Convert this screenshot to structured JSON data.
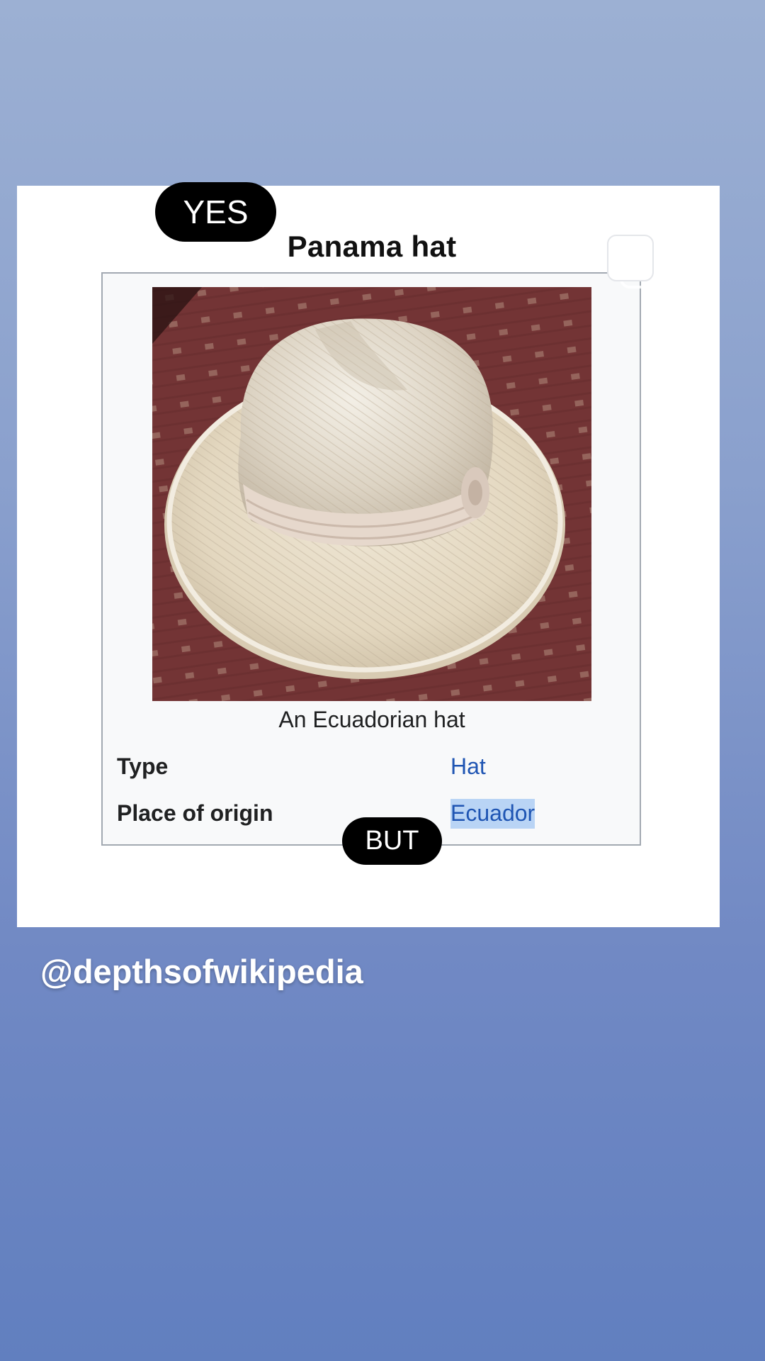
{
  "stickers": {
    "yes": "YES",
    "but": "BUT"
  },
  "infobox": {
    "title": "Panama hat",
    "image_caption": "An Ecuadorian hat",
    "rows": [
      {
        "label": "Type",
        "value": "Hat"
      },
      {
        "label": "Place of origin",
        "value": "Ecuador"
      }
    ]
  },
  "handle": "@depthsofwikipedia",
  "colors": {
    "background_top": "#9cb0d3",
    "background_bottom": "#617fbf",
    "link": "#1f55b3",
    "selection": "#b9d4f5",
    "sticker": "#000000"
  },
  "icons": {
    "copy": "copy-icon"
  }
}
